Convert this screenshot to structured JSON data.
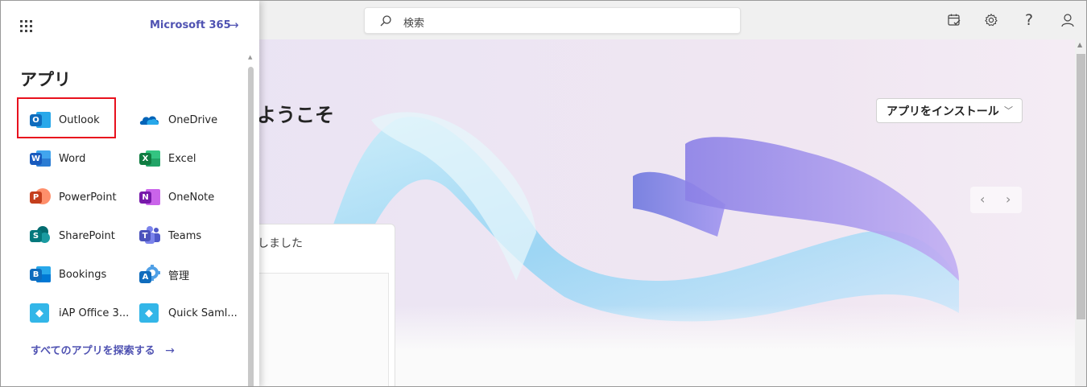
{
  "topbar": {
    "search_placeholder": "検索"
  },
  "launcher": {
    "m365_link": "Microsoft 365",
    "apps_title": "アプリ",
    "explore_all": "すべてのアプリを探索する",
    "apps": [
      {
        "label": "Outlook",
        "color": "#0f6cbd"
      },
      {
        "label": "OneDrive",
        "color": "#0364b8"
      },
      {
        "label": "Word",
        "color": "#185abd"
      },
      {
        "label": "Excel",
        "color": "#107c41"
      },
      {
        "label": "PowerPoint",
        "color": "#c43e1c"
      },
      {
        "label": "OneNote",
        "color": "#7719aa"
      },
      {
        "label": "SharePoint",
        "color": "#036c70"
      },
      {
        "label": "Teams",
        "color": "#5059c9"
      },
      {
        "label": "Bookings",
        "color": "#0f6cbd"
      },
      {
        "label": "管理",
        "color": "#0078d4"
      },
      {
        "label": "iAP Office 3...",
        "color": "#33b6e8"
      },
      {
        "label": "Quick Saml...",
        "color": "#33b6e8"
      }
    ]
  },
  "main": {
    "welcome": "ようこそ",
    "install_button": "アプリをインストール",
    "card_text": "しました"
  },
  "colors": {
    "accent": "#4f52b2",
    "highlight_border": "#e8111e"
  }
}
